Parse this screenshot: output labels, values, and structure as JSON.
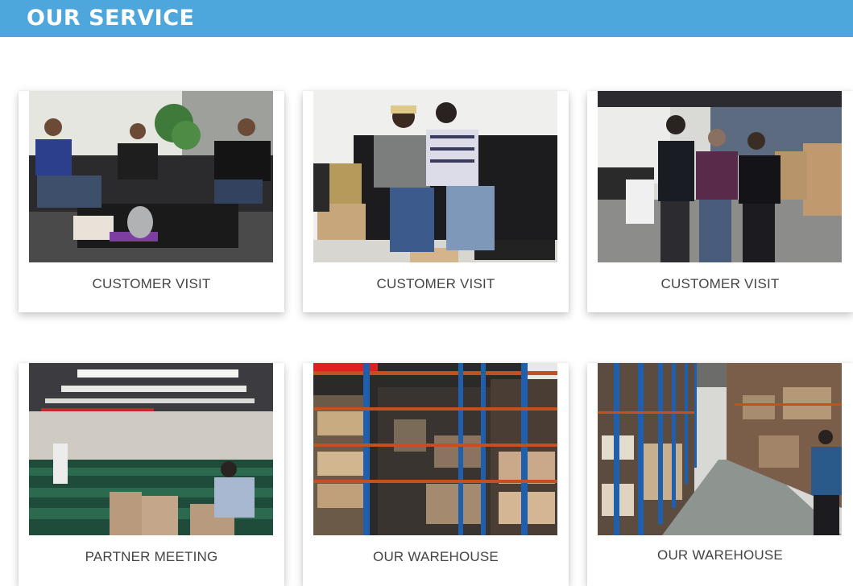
{
  "header": {
    "title": "OUR SERVICE"
  },
  "cards": [
    {
      "caption": "CUSTOMER VISIT",
      "image": "photo-office-lounge-meeting"
    },
    {
      "caption": "CUSTOMER VISIT",
      "image": "photo-two-men-on-sofa"
    },
    {
      "caption": "CUSTOMER VISIT",
      "image": "photo-office-handshake"
    },
    {
      "caption": "PARTNER MEETING",
      "image": "photo-conference-hall"
    },
    {
      "caption": "OUR WAREHOUSE",
      "image": "photo-warehouse-racks"
    },
    {
      "caption": "OUR WAREHOUSE",
      "image": "photo-warehouse-aisle"
    }
  ],
  "colors": {
    "header_bar": "#4ea7dc",
    "caption_text": "#444444",
    "rack_blue": "#1e5fb0"
  }
}
